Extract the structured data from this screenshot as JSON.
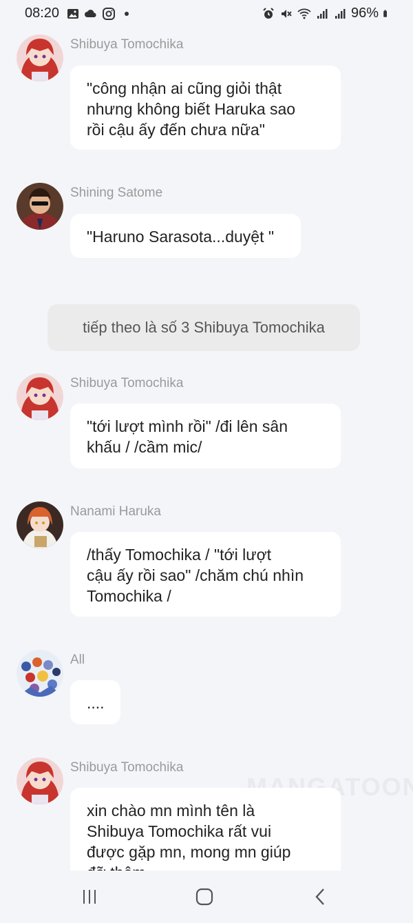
{
  "status_bar": {
    "time": "08:20",
    "battery": "96%",
    "left_icons": [
      "image-icon",
      "cloud-icon",
      "instagram-icon",
      "dot-icon"
    ],
    "right_icons": [
      "alarm-icon",
      "mute-icon",
      "wifi-icon",
      "signal-icon",
      "signal-icon",
      "battery-icon"
    ]
  },
  "messages": [
    {
      "sender": "Shibuya Tomochika",
      "avatar": "avatar-shibuya",
      "lines": [
        "\"công nhận ai cũng giỏi thật",
        "nhưng không biết Haruka sao",
        "rồi cậu ấy đến chưa nữa\""
      ]
    },
    {
      "sender": "Shining Satome",
      "avatar": "avatar-shining",
      "lines": [
        "\"Haruno Sarasota...duyệt \""
      ]
    },
    {
      "sender": "Shibuya Tomochika",
      "avatar": "avatar-shibuya",
      "lines": [
        "\"tới lượt mình rồi\" /đi lên sân",
        "khấu / /cầm mic/"
      ]
    },
    {
      "sender": "Nanami Haruka",
      "avatar": "avatar-haruka",
      "lines": [
        "/thấy Tomochika / \"tới lượt",
        "cậu ấy rồi sao\" /chăm chú nhìn",
        "Tomochika /"
      ]
    },
    {
      "sender": "All",
      "avatar": "avatar-all",
      "lines": [
        "...."
      ]
    },
    {
      "sender": "Shibuya Tomochika",
      "avatar": "avatar-shibuya",
      "lines": [
        "xin chào mn mình tên là",
        "Shibuya Tomochika rất vui",
        "được gặp mn, mong mn giúp",
        "đỡ thêm"
      ]
    }
  ],
  "narration": "tiếp theo là số 3 Shibuya Tomochika",
  "watermark": "MANGATOON",
  "nav": {
    "recents": "recents-icon",
    "home": "home-icon",
    "back": "back-icon"
  }
}
